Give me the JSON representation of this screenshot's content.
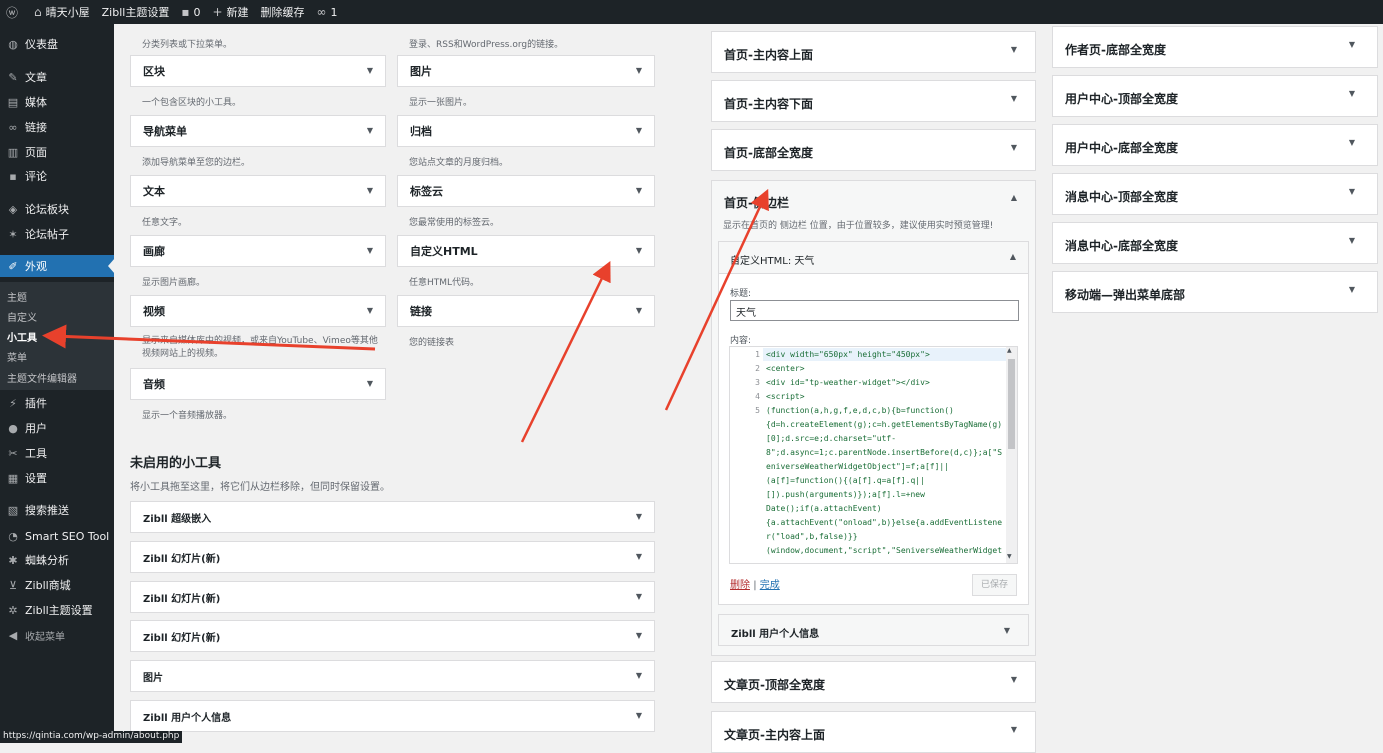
{
  "admin_bar": {
    "wp_logo": "wordpress-icon",
    "site_name": "晴天小屋",
    "theme_settings": "Zibll主题设置",
    "comments_count": "0",
    "new_label": "新建",
    "clear_cache": "删除缓存",
    "link_count": "1"
  },
  "sidebar": {
    "items": [
      {
        "icon": "dashboard-icon",
        "glyph": "◍",
        "label": "仪表盘"
      },
      {
        "icon": "pin-icon",
        "glyph": "✎",
        "label": "文章"
      },
      {
        "icon": "media-icon",
        "glyph": "▤",
        "label": "媒体"
      },
      {
        "icon": "link-icon",
        "glyph": "∞",
        "label": "链接"
      },
      {
        "icon": "page-icon",
        "glyph": "▥",
        "label": "页面"
      },
      {
        "icon": "comment-icon",
        "glyph": "▪",
        "label": "评论"
      },
      {
        "icon": "forum-board-icon",
        "glyph": "◈",
        "label": "论坛板块"
      },
      {
        "icon": "forum-post-icon",
        "glyph": "✶",
        "label": "论坛帖子"
      },
      {
        "icon": "appearance-icon",
        "glyph": "✐",
        "label": "外观"
      },
      {
        "icon": "plugin-icon",
        "glyph": "⚡",
        "label": "插件"
      },
      {
        "icon": "user-icon",
        "glyph": "●",
        "label": "用户"
      },
      {
        "icon": "tools-icon",
        "glyph": "✂",
        "label": "工具"
      },
      {
        "icon": "settings-icon",
        "glyph": "▦",
        "label": "设置"
      },
      {
        "icon": "search-push-icon",
        "glyph": "▧",
        "label": "搜索推送"
      },
      {
        "icon": "seo-icon",
        "glyph": "◔",
        "label": "Smart SEO Tool"
      },
      {
        "icon": "spider-icon",
        "glyph": "✱",
        "label": "蜘蛛分析"
      },
      {
        "icon": "cart-icon",
        "glyph": "⊻",
        "label": "Zibll商城"
      },
      {
        "icon": "gear-icon",
        "glyph": "✲",
        "label": "Zibll主题设置"
      },
      {
        "icon": "collapse-icon",
        "glyph": "◀",
        "label": "收起菜单"
      }
    ],
    "submenu": [
      "主题",
      "自定义",
      "小工具",
      "菜单",
      "主题文件编辑器"
    ]
  },
  "available_widgets": {
    "top_desc_left": "分类列表或下拉菜单。",
    "top_desc_right": "登录、RSS和WordPress.org的链接。",
    "rows": [
      {
        "left": "区块",
        "left_desc": "一个包含区块的小工具。",
        "right": "图片",
        "right_desc": "显示一张图片。"
      },
      {
        "left": "导航菜单",
        "left_desc": "添加导航菜单至您的边栏。",
        "right": "归档",
        "right_desc": "您站点文章的月度归档。"
      },
      {
        "left": "文本",
        "left_desc": "任意文字。",
        "right": "标签云",
        "right_desc": "您最常使用的标签云。"
      },
      {
        "left": "画廊",
        "left_desc": "显示图片画廊。",
        "right": "自定义HTML",
        "right_desc": "任意HTML代码。"
      },
      {
        "left": "视频",
        "left_desc": "显示来自媒体库中的视频，或来自YouTube、Vimeo等其他视频网站上的视频。",
        "right": "链接",
        "right_desc": "您的链接表"
      },
      {
        "left": "音频",
        "left_desc": "显示一个音频播放器。",
        "right": "",
        "right_desc": ""
      }
    ]
  },
  "inactive": {
    "title": "未启用的小工具",
    "desc": "将小工具拖至这里，将它们从边栏移除，但同时保留设置。",
    "items": [
      "Zibll 超级嵌入",
      "Zibll 幻灯片(新)",
      "Zibll 幻灯片(新)",
      "Zibll 幻灯片(新)",
      "图片",
      "Zibll 用户个人信息"
    ]
  },
  "sidebars_col1": {
    "top": [
      "首页-主内容上面",
      "首页-主内容下面",
      "首页-底部全宽度"
    ],
    "open": {
      "title": "首页-侧边栏",
      "desc": "显示在首页的 侧边栏 位置，由于位置较多，建议使用实时预览管理!",
      "widget_title": "自定义HTML: 天气",
      "title_label": "标题:",
      "title_value": "天气",
      "content_label": "内容:",
      "delete": "删除",
      "sep": "|",
      "done": "完成",
      "saved": "已保存",
      "next_widget": "Zibll 用户个人信息"
    },
    "bottom": [
      "文章页-顶部全宽度",
      "文章页-主内容上面"
    ]
  },
  "code": {
    "numbers": [
      "1",
      "2",
      "3",
      "4",
      "5"
    ],
    "lines": [
      "<div width=\"650px\" height=\"450px\">",
      "<center>",
      "<div id=\"tp-weather-widget\"></div>",
      "<script>",
      "  (function(a,h,g,f,e,d,c,b){b=function()",
      "{d=h.createElement(g);c=h.getElementsByTagName(g)",
      "[0];d.src=e;d.charset=\"utf-",
      "8\";d.async=1;c.parentNode.insertBefore(d,c)};a[\"S",
      "eniverseWeatherWidgetObject\"]=f;a[f]||",
      "(a[f]=function(){(a[f].q=a[f].q||",
      "[]).push(arguments)});a[f].l=+new",
      "Date();if(a.attachEvent)",
      "{a.attachEvent(\"onload\",b)}else{a.addEventListene",
      "r(\"load\",b,false)}}",
      "(window,document,\"script\",\"SeniverseWeatherWidget"
    ]
  },
  "sidebars_col2": [
    "作者页-底部全宽度",
    "用户中心-顶部全宽度",
    "用户中心-底部全宽度",
    "消息中心-顶部全宽度",
    "消息中心-底部全宽度",
    "移动端—弹出菜单底部"
  ],
  "status_url": "https://qintia.com/wp-admin/about.php",
  "colors": {
    "accent": "#2271b1",
    "arrow": "#e8412c",
    "admin_bg": "#1d2327"
  }
}
